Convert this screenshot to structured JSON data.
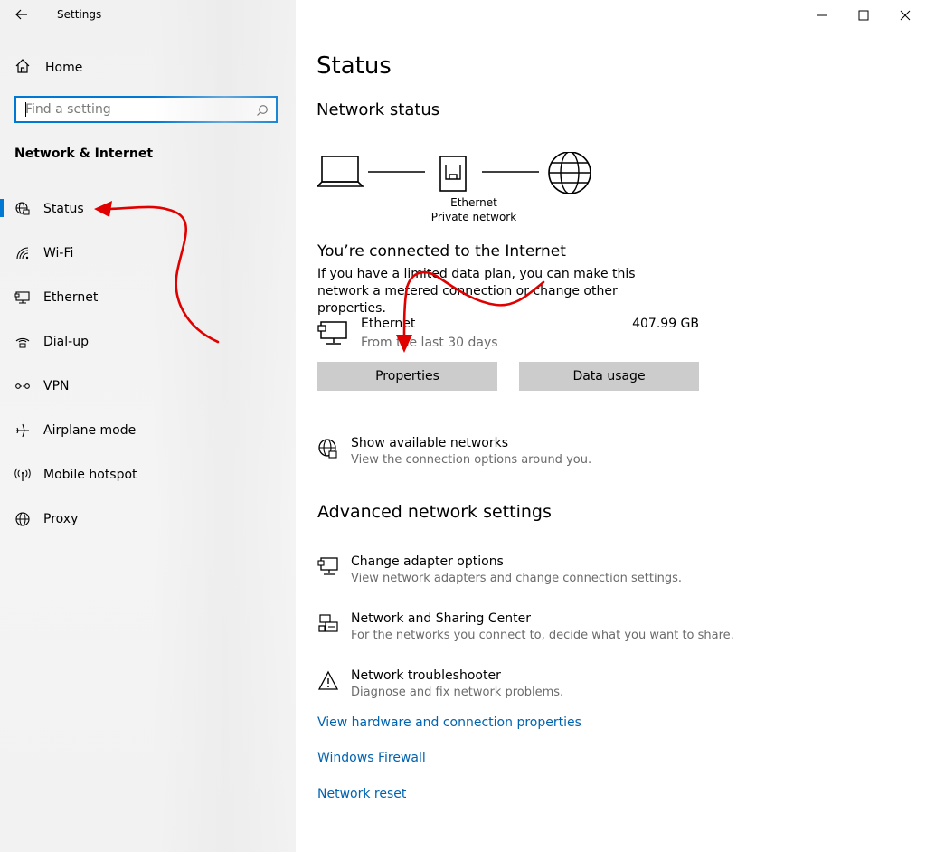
{
  "window": {
    "title": "Settings",
    "controls": [
      "minimize",
      "maximize",
      "close"
    ]
  },
  "sidebar": {
    "home_label": "Home",
    "search_placeholder": "Find a setting",
    "section_title": "Network & Internet",
    "items": [
      {
        "label": "Status",
        "icon": "globe-status-icon",
        "active": true
      },
      {
        "label": "Wi-Fi",
        "icon": "wifi-icon",
        "active": false
      },
      {
        "label": "Ethernet",
        "icon": "ethernet-icon",
        "active": false
      },
      {
        "label": "Dial-up",
        "icon": "dialup-icon",
        "active": false
      },
      {
        "label": "VPN",
        "icon": "vpn-icon",
        "active": false
      },
      {
        "label": "Airplane mode",
        "icon": "airplane-icon",
        "active": false
      },
      {
        "label": "Mobile hotspot",
        "icon": "hotspot-icon",
        "active": false
      },
      {
        "label": "Proxy",
        "icon": "globe-icon",
        "active": false
      }
    ]
  },
  "main": {
    "title": "Status",
    "network_status_title": "Network status",
    "diagram": {
      "adapter_name": "Ethernet",
      "network_type": "Private network"
    },
    "connected_title": "You’re connected to the Internet",
    "connected_desc": "If you have a limited data plan, you can make this network a metered connection or change other properties.",
    "connection": {
      "name": "Ethernet",
      "period": "From the last 30 days",
      "usage": "407.99 GB"
    },
    "buttons": {
      "properties": "Properties",
      "data_usage": "Data usage"
    },
    "show_networks": {
      "title": "Show available networks",
      "subtitle": "View the connection options around you."
    },
    "advanced_title": "Advanced network settings",
    "advanced_options": [
      {
        "title": "Change adapter options",
        "subtitle": "View network adapters and change connection settings."
      },
      {
        "title": "Network and Sharing Center",
        "subtitle": "For the networks you connect to, decide what you want to share."
      },
      {
        "title": "Network troubleshooter",
        "subtitle": "Diagnose and fix network problems."
      }
    ],
    "links": [
      "View hardware and connection properties",
      "Windows Firewall",
      "Network reset"
    ]
  },
  "colors": {
    "accent": "#0078d4",
    "link": "#0063b1",
    "button_bg": "#cccccc",
    "annotation": "#e00000"
  }
}
